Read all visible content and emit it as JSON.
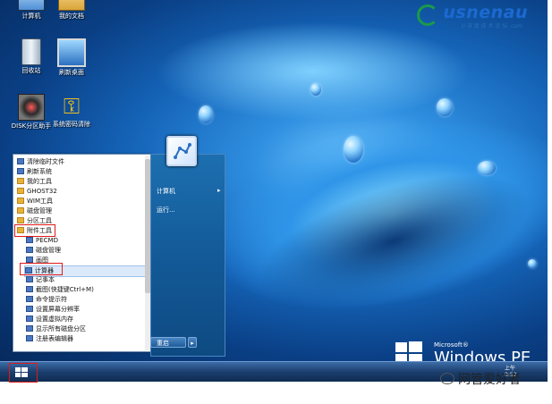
{
  "logo": {
    "brand": "usnenau",
    "sub": "U 深 度 技 术 论 坛 .com"
  },
  "desktop_icons": [
    {
      "label": "计算机",
      "icon": "computer-icon"
    },
    {
      "label": "我的文档",
      "icon": "documents-icon"
    },
    {
      "label": "回收站",
      "icon": "recycle-bin-icon"
    },
    {
      "label": "刷新桌面",
      "icon": "refresh-desktop-icon"
    },
    {
      "label": "DISK分区助手",
      "icon": "disk-partition-icon"
    },
    {
      "label": "系统密码清除",
      "icon": "key-icon"
    }
  ],
  "start_menu": {
    "items": [
      {
        "label": "清除临时文件",
        "icon": "app"
      },
      {
        "label": "刷新系统",
        "icon": "app"
      },
      {
        "label": "我的工具",
        "icon": "folder"
      },
      {
        "label": "GHOST32",
        "icon": "folder"
      },
      {
        "label": "WIM工具",
        "icon": "folder"
      },
      {
        "label": "磁盘管理",
        "icon": "folder"
      },
      {
        "label": "分区工具",
        "icon": "folder"
      },
      {
        "label": "附件工具",
        "icon": "folder"
      },
      {
        "label": "PECMD",
        "icon": "app"
      },
      {
        "label": "磁盘管理",
        "icon": "app"
      },
      {
        "label": "画图",
        "icon": "app"
      },
      {
        "label": "计算器",
        "icon": "app"
      },
      {
        "label": "记事本",
        "icon": "app"
      },
      {
        "label": "截图(快捷键Ctrl+M)",
        "icon": "app"
      },
      {
        "label": "命令提示符",
        "icon": "app"
      },
      {
        "label": "设置屏幕分辨率",
        "icon": "app"
      },
      {
        "label": "设置虚拟内存",
        "icon": "app"
      },
      {
        "label": "显示所有磁盘分区",
        "icon": "app"
      },
      {
        "label": "注册表编辑器",
        "icon": "app"
      }
    ],
    "right": {
      "computer": "计算机",
      "run": "运行..."
    },
    "restart": "重启",
    "restart_arrow": "▸"
  },
  "system": {
    "os_label": "Windows PE",
    "vendor": "Microsoft®",
    "time": "8:52",
    "time_prefix": "上午"
  },
  "watermark": "网管爱好者",
  "colors": {
    "highlight": "#e01a1a",
    "taskbar": "#1b3f6e",
    "desktop": "#1564b8"
  }
}
